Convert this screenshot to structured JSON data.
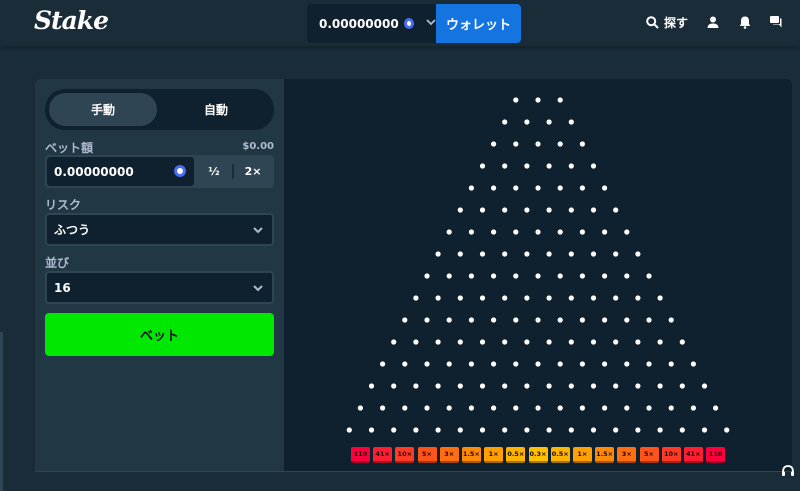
{
  "header": {
    "logo": "Stake",
    "balance": "0.00000000",
    "wallet_label": "ウォレット",
    "search_label": "探す",
    "icons": [
      "search-icon",
      "user-icon",
      "bell-icon",
      "chat-icon"
    ]
  },
  "sidebar": {
    "mode_manual": "手動",
    "mode_auto": "自動",
    "bet_amount_label": "ベット額",
    "bet_amount_usd": "$0.00",
    "bet_amount_value": "0.00000000",
    "half_label": "½",
    "double_label": "2×",
    "risk_label": "リスク",
    "risk_value": "ふつう",
    "rows_label": "並び",
    "rows_value": "16",
    "bet_button": "ベット"
  },
  "game": {
    "rows": 16,
    "multipliers": [
      {
        "label": "110",
        "color": "#ff003f"
      },
      {
        "label": "41×",
        "color": "#ff1e32"
      },
      {
        "label": "10×",
        "color": "#ff3a26"
      },
      {
        "label": "5×",
        "color": "#ff5419"
      },
      {
        "label": "3×",
        "color": "#ff6e10"
      },
      {
        "label": "1.5×",
        "color": "#ff8a06"
      },
      {
        "label": "1×",
        "color": "#ffa000"
      },
      {
        "label": "0.5×",
        "color": "#ffb400"
      },
      {
        "label": "0.3×",
        "color": "#ffc000"
      },
      {
        "label": "0.5×",
        "color": "#ffb400"
      },
      {
        "label": "1×",
        "color": "#ffa000"
      },
      {
        "label": "1.5×",
        "color": "#ff8a06"
      },
      {
        "label": "3×",
        "color": "#ff6e10"
      },
      {
        "label": "5×",
        "color": "#ff5419"
      },
      {
        "label": "10×",
        "color": "#ff3a26"
      },
      {
        "label": "41×",
        "color": "#ff1e32"
      },
      {
        "label": "110",
        "color": "#ff003f"
      }
    ]
  },
  "colors": {
    "accent_green": "#00e701",
    "wallet_blue": "#1475e1",
    "panel": "#213743",
    "stage": "#0f212e"
  }
}
